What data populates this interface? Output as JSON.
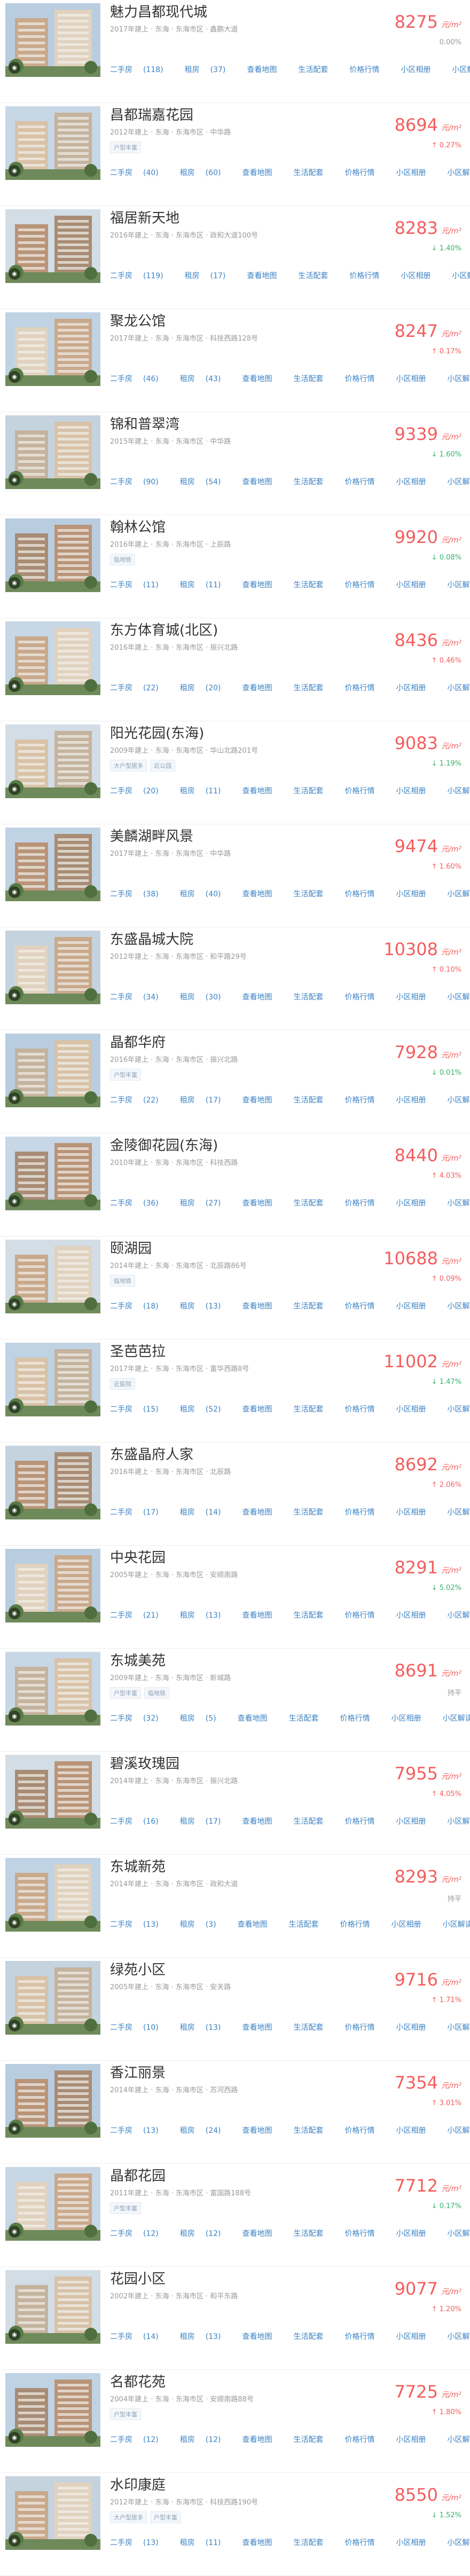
{
  "colors": {
    "price": "#f45d5d",
    "link": "#3b82c4",
    "down": "#36b36d",
    "meta": "#999999"
  },
  "icons": {
    "thumbnail_badge": "vr-camera-icon"
  },
  "link_labels": [
    "二手房",
    "租房",
    "查看地图",
    "生活配套",
    "价格行情",
    "小区相册",
    "小区解读"
  ],
  "unit": "元/m²",
  "listings": [
    {
      "name": "魅力昌都现代城",
      "meta": "2017年建上 · 东海 · 东海市区 · 鑫鹏大道",
      "tags": [],
      "price": "8275",
      "change": "0.00%",
      "trend": "flat",
      "sale_count": "(118)",
      "rent_count": "(37)"
    },
    {
      "name": "昌都瑞嘉花园",
      "meta": "2012年建上 · 东海 · 东海市区 · 中华路",
      "tags": [
        "户型丰富"
      ],
      "price": "8694",
      "change": "0.27%",
      "trend": "up",
      "sale_count": "(40)",
      "rent_count": "(60)"
    },
    {
      "name": "福居新天地",
      "meta": "2016年建上 · 东海 · 东海市区 · 政和大道100号",
      "tags": [],
      "price": "8283",
      "change": "1.40%",
      "trend": "down",
      "sale_count": "(119)",
      "rent_count": "(17)"
    },
    {
      "name": "聚龙公馆",
      "meta": "2017年建上 · 东海 · 东海市区 · 科技西路128号",
      "tags": [],
      "price": "8247",
      "change": "0.17%",
      "trend": "up",
      "sale_count": "(46)",
      "rent_count": "(43)"
    },
    {
      "name": "锦和普翠湾",
      "meta": "2015年建上 · 东海 · 东海市区 · 中华路",
      "tags": [],
      "price": "9339",
      "change": "1.60%",
      "trend": "down",
      "sale_count": "(90)",
      "rent_count": "(54)"
    },
    {
      "name": "翰林公馆",
      "meta": "2016年建上 · 东海 · 东海市区 · 上辰路",
      "tags": [
        "临地铁"
      ],
      "price": "9920",
      "change": "0.08%",
      "trend": "down",
      "sale_count": "(11)",
      "rent_count": "(11)"
    },
    {
      "name": "东方体育城(北区)",
      "meta": "2016年建上 · 东海 · 东海市区 · 振兴北路",
      "tags": [],
      "price": "8436",
      "change": "0.46%",
      "trend": "up",
      "sale_count": "(22)",
      "rent_count": "(20)"
    },
    {
      "name": "阳光花园(东海)",
      "meta": "2009年建上 · 东海 · 东海市区 · 华山北路201号",
      "tags": [
        "大户型居多",
        "近公园"
      ],
      "price": "9083",
      "change": "1.19%",
      "trend": "down",
      "sale_count": "(20)",
      "rent_count": "(11)"
    },
    {
      "name": "美麟湖畔风景",
      "meta": "2017年建上 · 东海 · 东海市区 · 中华路",
      "tags": [],
      "price": "9474",
      "change": "1.60%",
      "trend": "up",
      "sale_count": "(38)",
      "rent_count": "(40)"
    },
    {
      "name": "东盛晶城大院",
      "meta": "2012年建上 · 东海 · 东海市区 · 和平路29号",
      "tags": [],
      "price": "10308",
      "change": "0.10%",
      "trend": "up",
      "sale_count": "(34)",
      "rent_count": "(30)"
    },
    {
      "name": "晶都华府",
      "meta": "2016年建上 · 东海 · 东海市区 · 振兴北路",
      "tags": [
        "户型丰富"
      ],
      "price": "7928",
      "change": "0.01%",
      "trend": "down",
      "sale_count": "(22)",
      "rent_count": "(17)"
    },
    {
      "name": "金陵御花园(东海)",
      "meta": "2010年建上 · 东海 · 东海市区 · 科技西路",
      "tags": [],
      "price": "8440",
      "change": "4.03%",
      "trend": "up",
      "sale_count": "(36)",
      "rent_count": "(27)"
    },
    {
      "name": "颐湖园",
      "meta": "2014年建上 · 东海 · 东海市区 · 北辰路86号",
      "tags": [
        "临地铁"
      ],
      "price": "10688",
      "change": "0.09%",
      "trend": "up",
      "sale_count": "(18)",
      "rent_count": "(13)"
    },
    {
      "name": "圣芭芭拉",
      "meta": "2017年建上 · 东海 · 东海市区 · 富华西路8号",
      "tags": [
        "近医院"
      ],
      "price": "11002",
      "change": "1.47%",
      "trend": "down",
      "sale_count": "(15)",
      "rent_count": "(52)"
    },
    {
      "name": "东盛晶府人家",
      "meta": "2016年建上 · 东海 · 东海市区 · 北辰路",
      "tags": [],
      "price": "8692",
      "change": "2.06%",
      "trend": "up",
      "sale_count": "(17)",
      "rent_count": "(14)"
    },
    {
      "name": "中央花园",
      "meta": "2005年建上 · 东海 · 东海市区 · 安顺南路",
      "tags": [],
      "price": "8291",
      "change": "5.02%",
      "trend": "down",
      "sale_count": "(21)",
      "rent_count": "(13)"
    },
    {
      "name": "东城美苑",
      "meta": "2009年建上 · 东海 · 东海市区 · 新城路",
      "tags": [
        "户型丰富",
        "临地铁"
      ],
      "price": "8691",
      "change": "持平",
      "trend": "flat",
      "sale_count": "(32)",
      "rent_count": "(5)"
    },
    {
      "name": "碧溪玫瑰园",
      "meta": "2014年建上 · 东海 · 东海市区 · 振兴北路",
      "tags": [],
      "price": "7955",
      "change": "4.05%",
      "trend": "up",
      "sale_count": "(16)",
      "rent_count": "(17)"
    },
    {
      "name": "东城新苑",
      "meta": "2014年建上 · 东海 · 东海市区 · 政和大道",
      "tags": [],
      "price": "8293",
      "change": "持平",
      "trend": "flat",
      "sale_count": "(13)",
      "rent_count": "(3)"
    },
    {
      "name": "绿苑小区",
      "meta": "2005年建上 · 东海 · 东海市区 · 安关路",
      "tags": [],
      "price": "9716",
      "change": "1.71%",
      "trend": "up",
      "sale_count": "(10)",
      "rent_count": "(13)"
    },
    {
      "name": "香江丽景",
      "meta": "2014年建上 · 东海 · 东海市区 · 苏河西路",
      "tags": [],
      "price": "7354",
      "change": "3.01%",
      "trend": "up",
      "sale_count": "(13)",
      "rent_count": "(24)"
    },
    {
      "name": "晶都花园",
      "meta": "2011年建上 · 东海 · 东海市区 · 富国路188号",
      "tags": [
        "户型丰富"
      ],
      "price": "7712",
      "change": "0.17%",
      "trend": "down",
      "sale_count": "(12)",
      "rent_count": "(12)"
    },
    {
      "name": "花园小区",
      "meta": "2002年建上 · 东海 · 东海市区 · 和平东路",
      "tags": [],
      "price": "9077",
      "change": "1.20%",
      "trend": "up",
      "sale_count": "(14)",
      "rent_count": "(13)"
    },
    {
      "name": "名都花苑",
      "meta": "2004年建上 · 东海 · 东海市区 · 安顺南路88号",
      "tags": [
        "户型丰富"
      ],
      "price": "7725",
      "change": "1.80%",
      "trend": "up",
      "sale_count": "(12)",
      "rent_count": "(12)"
    },
    {
      "name": "水印康庭",
      "meta": "2012年建上 · 东海 · 东海市区 · 科技西路190号",
      "tags": [
        "大户型居多",
        "户型丰富"
      ],
      "price": "8550",
      "change": "1.52%",
      "trend": "down",
      "sale_count": "(13)",
      "rent_count": "(11)"
    }
  ]
}
